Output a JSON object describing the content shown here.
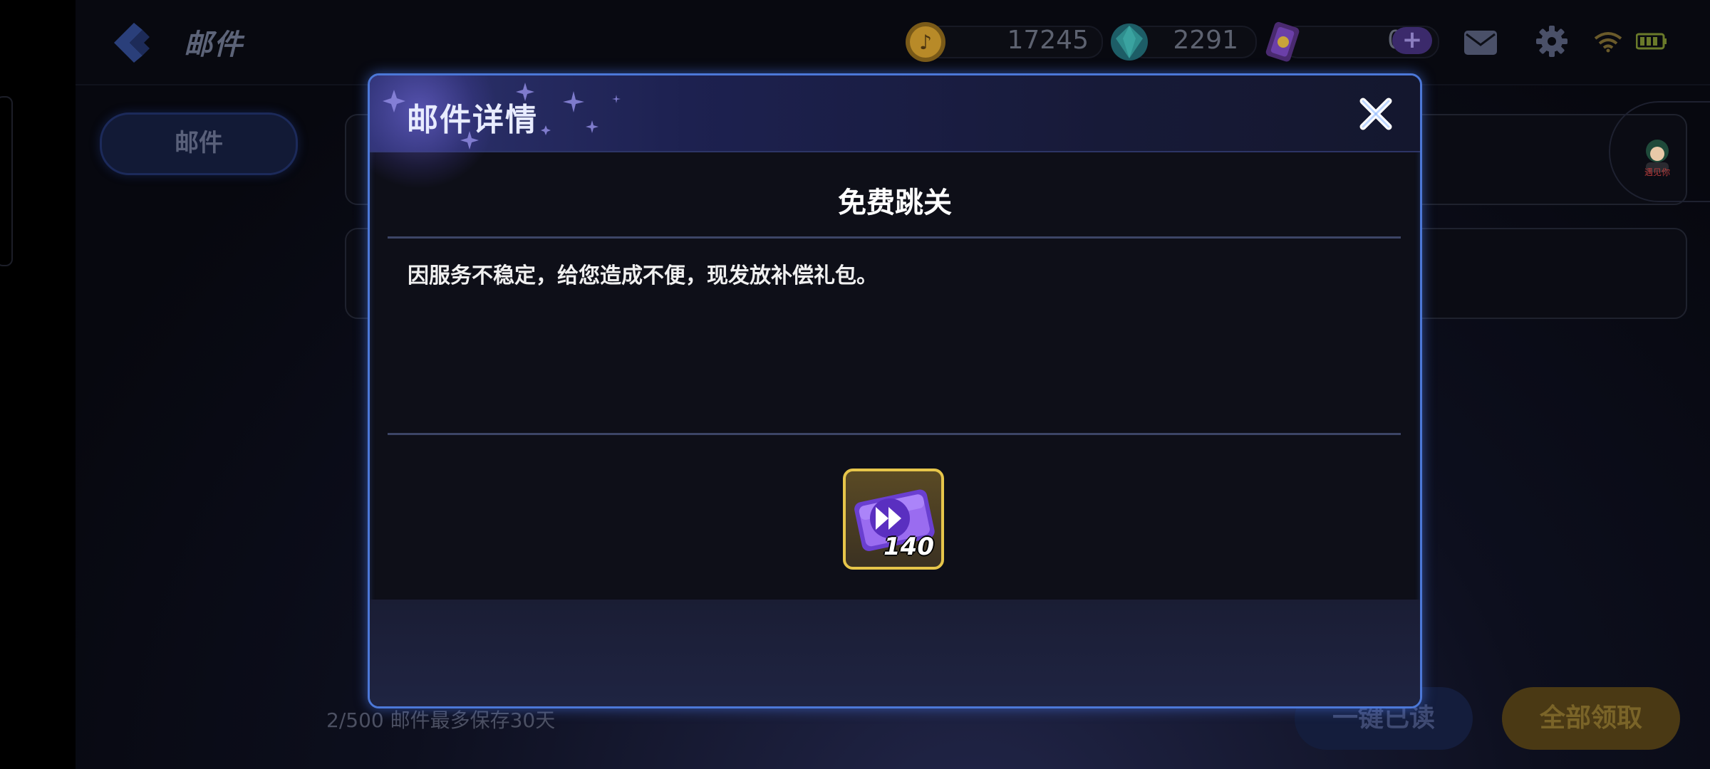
{
  "topbar": {
    "title": "邮件",
    "currencies": [
      {
        "name": "gold-coin",
        "value": "17245",
        "color": "#c8962a"
      },
      {
        "name": "gem",
        "value": "2291",
        "color": "#2d8a8e"
      },
      {
        "name": "ticket",
        "value": "0",
        "color": "#6b3fa8"
      }
    ],
    "plus_label": "+"
  },
  "sidebar": {
    "tab_mail": "邮件"
  },
  "footer": {
    "info": "2/500 邮件最多保存30天",
    "read_all": "一键已读",
    "claim_all": "全部领取"
  },
  "avatar": {
    "label": "遇见你"
  },
  "modal": {
    "title": "邮件详情",
    "subject": "免费跳关",
    "body": "因服务不稳定，给您造成不便，现发放补偿礼包。",
    "reward": {
      "icon": "skip-ticket-icon",
      "count": "140",
      "border_color": "#e6c54a"
    }
  },
  "colors": {
    "modal_border": "#4c78d8",
    "accent_purple": "#3b2a6b"
  }
}
